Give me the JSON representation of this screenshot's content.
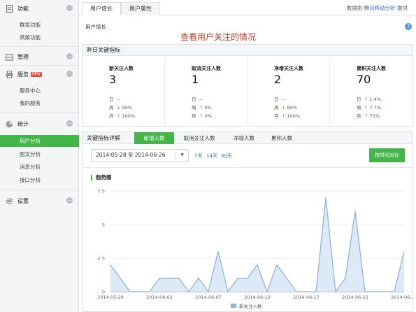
{
  "sidebar": {
    "sections": [
      {
        "label": "功能",
        "icon": "document-icon",
        "items": [
          "群发功能",
          "高级功能"
        ]
      },
      {
        "label": "管理",
        "icon": "inbox-icon",
        "items": []
      },
      {
        "label": "服务",
        "icon": "printer-icon",
        "badge": "NEW",
        "items": [
          "服务中心",
          "我的服务"
        ]
      },
      {
        "label": "统计",
        "icon": "pie-chart-icon",
        "items": [
          "用户分析",
          "图文分析",
          "消息分析",
          "接口分析"
        ],
        "active_item": "用户分析"
      },
      {
        "label": "设置",
        "icon": "gear-icon",
        "items": []
      }
    ]
  },
  "tabs": [
    "用户增长",
    "用户属性"
  ],
  "active_tab": "用户增长",
  "provider": {
    "prefix": "数据由",
    "link": "腾讯移动分析",
    "suffix": "提供"
  },
  "breadcrumb": "用户增长",
  "annotation": "查看用户关注的情况",
  "yesterday": {
    "title": "昨日关键指标",
    "metrics": [
      {
        "name": "新关注人数",
        "value": "3",
        "day_label": "日",
        "day": "--",
        "week_label": "周",
        "week_dir": "down",
        "week": "50%",
        "month_label": "月",
        "month_dir": "up",
        "month": "200%"
      },
      {
        "name": "取消关注人数",
        "value": "1",
        "day_label": "日",
        "day": "--",
        "week_label": "周",
        "week_dir": "up",
        "week": "0%",
        "month_label": "月",
        "month_dir": "up",
        "month": "0%"
      },
      {
        "name": "净增关注人数",
        "value": "2",
        "day_label": "日",
        "day": "--",
        "week_label": "周",
        "week_dir": "down",
        "week": "60%",
        "month_label": "月",
        "month_dir": "up",
        "month": "100%"
      },
      {
        "name": "累积关注人数",
        "value": "70",
        "day_label": "日",
        "day_dir": "up",
        "day": "1.4%",
        "week_label": "周",
        "week_dir": "up",
        "week": "7.7%",
        "month_label": "月",
        "month_dir": "up",
        "month": "75%"
      }
    ]
  },
  "details": {
    "title": "关键指标详解",
    "tabs": [
      "新增人数",
      "取消关注人数",
      "净增人数",
      "累积人数"
    ],
    "active_tab": "新增人数",
    "date_from": "2014-05-28",
    "date_sep": "至",
    "date_to": "2014-06-26",
    "quick_ranges": [
      "7天",
      "14天",
      "30天"
    ],
    "compare_button": "按时间对比",
    "trend_title": "趋势图"
  },
  "colors": {
    "accent": "#44b549",
    "link": "#2a70b8",
    "line": "#8fb2dd",
    "fill": "#d6e5f5"
  },
  "chart_data": {
    "type": "area",
    "title": "趋势图",
    "series": [
      {
        "name": "新关注人数",
        "values": [
          2,
          1,
          0,
          0,
          0,
          1,
          1,
          1,
          0,
          1,
          0,
          3,
          0,
          1,
          1,
          2,
          0,
          2,
          1,
          0,
          0,
          0,
          7,
          0,
          1,
          6,
          0,
          0,
          0,
          0,
          3
        ]
      }
    ],
    "x_tick_labels": [
      "2014-05-28",
      "2014-06-02",
      "2014-06-07",
      "2014-06-12",
      "2014-06-17",
      "2014-06-22",
      "2014-06-27"
    ],
    "y_tick_labels": [
      "0",
      "2.5",
      "5",
      "7.5"
    ],
    "ylim": [
      0,
      7.5
    ],
    "grid": true,
    "legend": "bottom"
  }
}
